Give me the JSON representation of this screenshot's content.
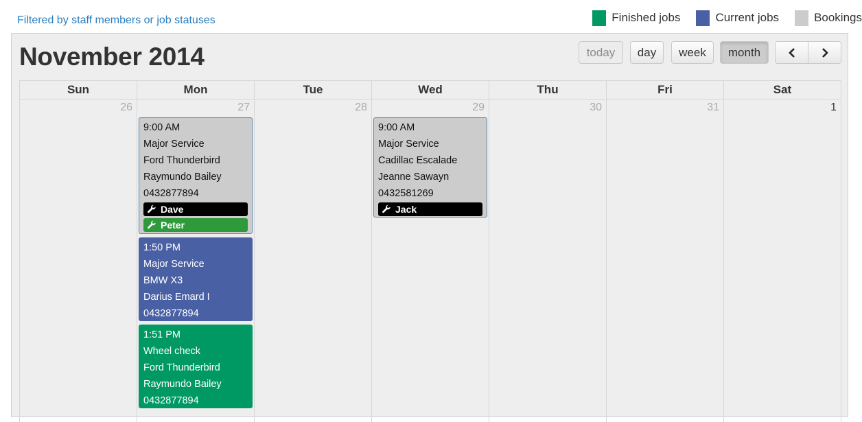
{
  "filter_link": "Filtered by staff members or job statuses",
  "legend": [
    {
      "label": "Finished jobs",
      "color": "#009963"
    },
    {
      "label": "Current jobs",
      "color": "#4a60a4"
    },
    {
      "label": "Bookings",
      "color": "#cccccc"
    }
  ],
  "calendar": {
    "title": "November 2014",
    "buttons": {
      "today": "today",
      "day": "day",
      "week": "week",
      "month": "month",
      "prev_icon": "chevron-left-icon",
      "next_icon": "chevron-right-icon"
    },
    "active_view": "month",
    "day_headers": [
      "Sun",
      "Mon",
      "Tue",
      "Wed",
      "Thu",
      "Fri",
      "Sat"
    ],
    "dates": [
      "26",
      "27",
      "28",
      "29",
      "30",
      "31",
      "1"
    ],
    "events": {
      "mon_booking": {
        "time": "9:00 AM",
        "service": "Major Service",
        "vehicle": "Ford Thunderbird",
        "customer": "Raymundo Bailey",
        "phone": "0432877894",
        "staff": [
          {
            "name": "Dave",
            "color": "#000000"
          },
          {
            "name": "Peter",
            "color": "#2e9a3c"
          }
        ]
      },
      "mon_current": {
        "time": "1:50 PM",
        "service": "Major Service",
        "vehicle": "BMW X3",
        "customer": "Darius Emard I",
        "phone": "0432877894"
      },
      "mon_finished": {
        "time": "1:51 PM",
        "service": "Wheel check",
        "vehicle": "Ford Thunderbird",
        "customer": "Raymundo Bailey",
        "phone": "0432877894"
      },
      "wed_booking": {
        "time": "9:00 AM",
        "service": "Major Service",
        "vehicle": "Cadillac Escalade",
        "customer": "Jeanne Sawayn",
        "phone": "0432581269",
        "staff": [
          {
            "name": "Jack",
            "color": "#000000"
          }
        ]
      }
    }
  }
}
